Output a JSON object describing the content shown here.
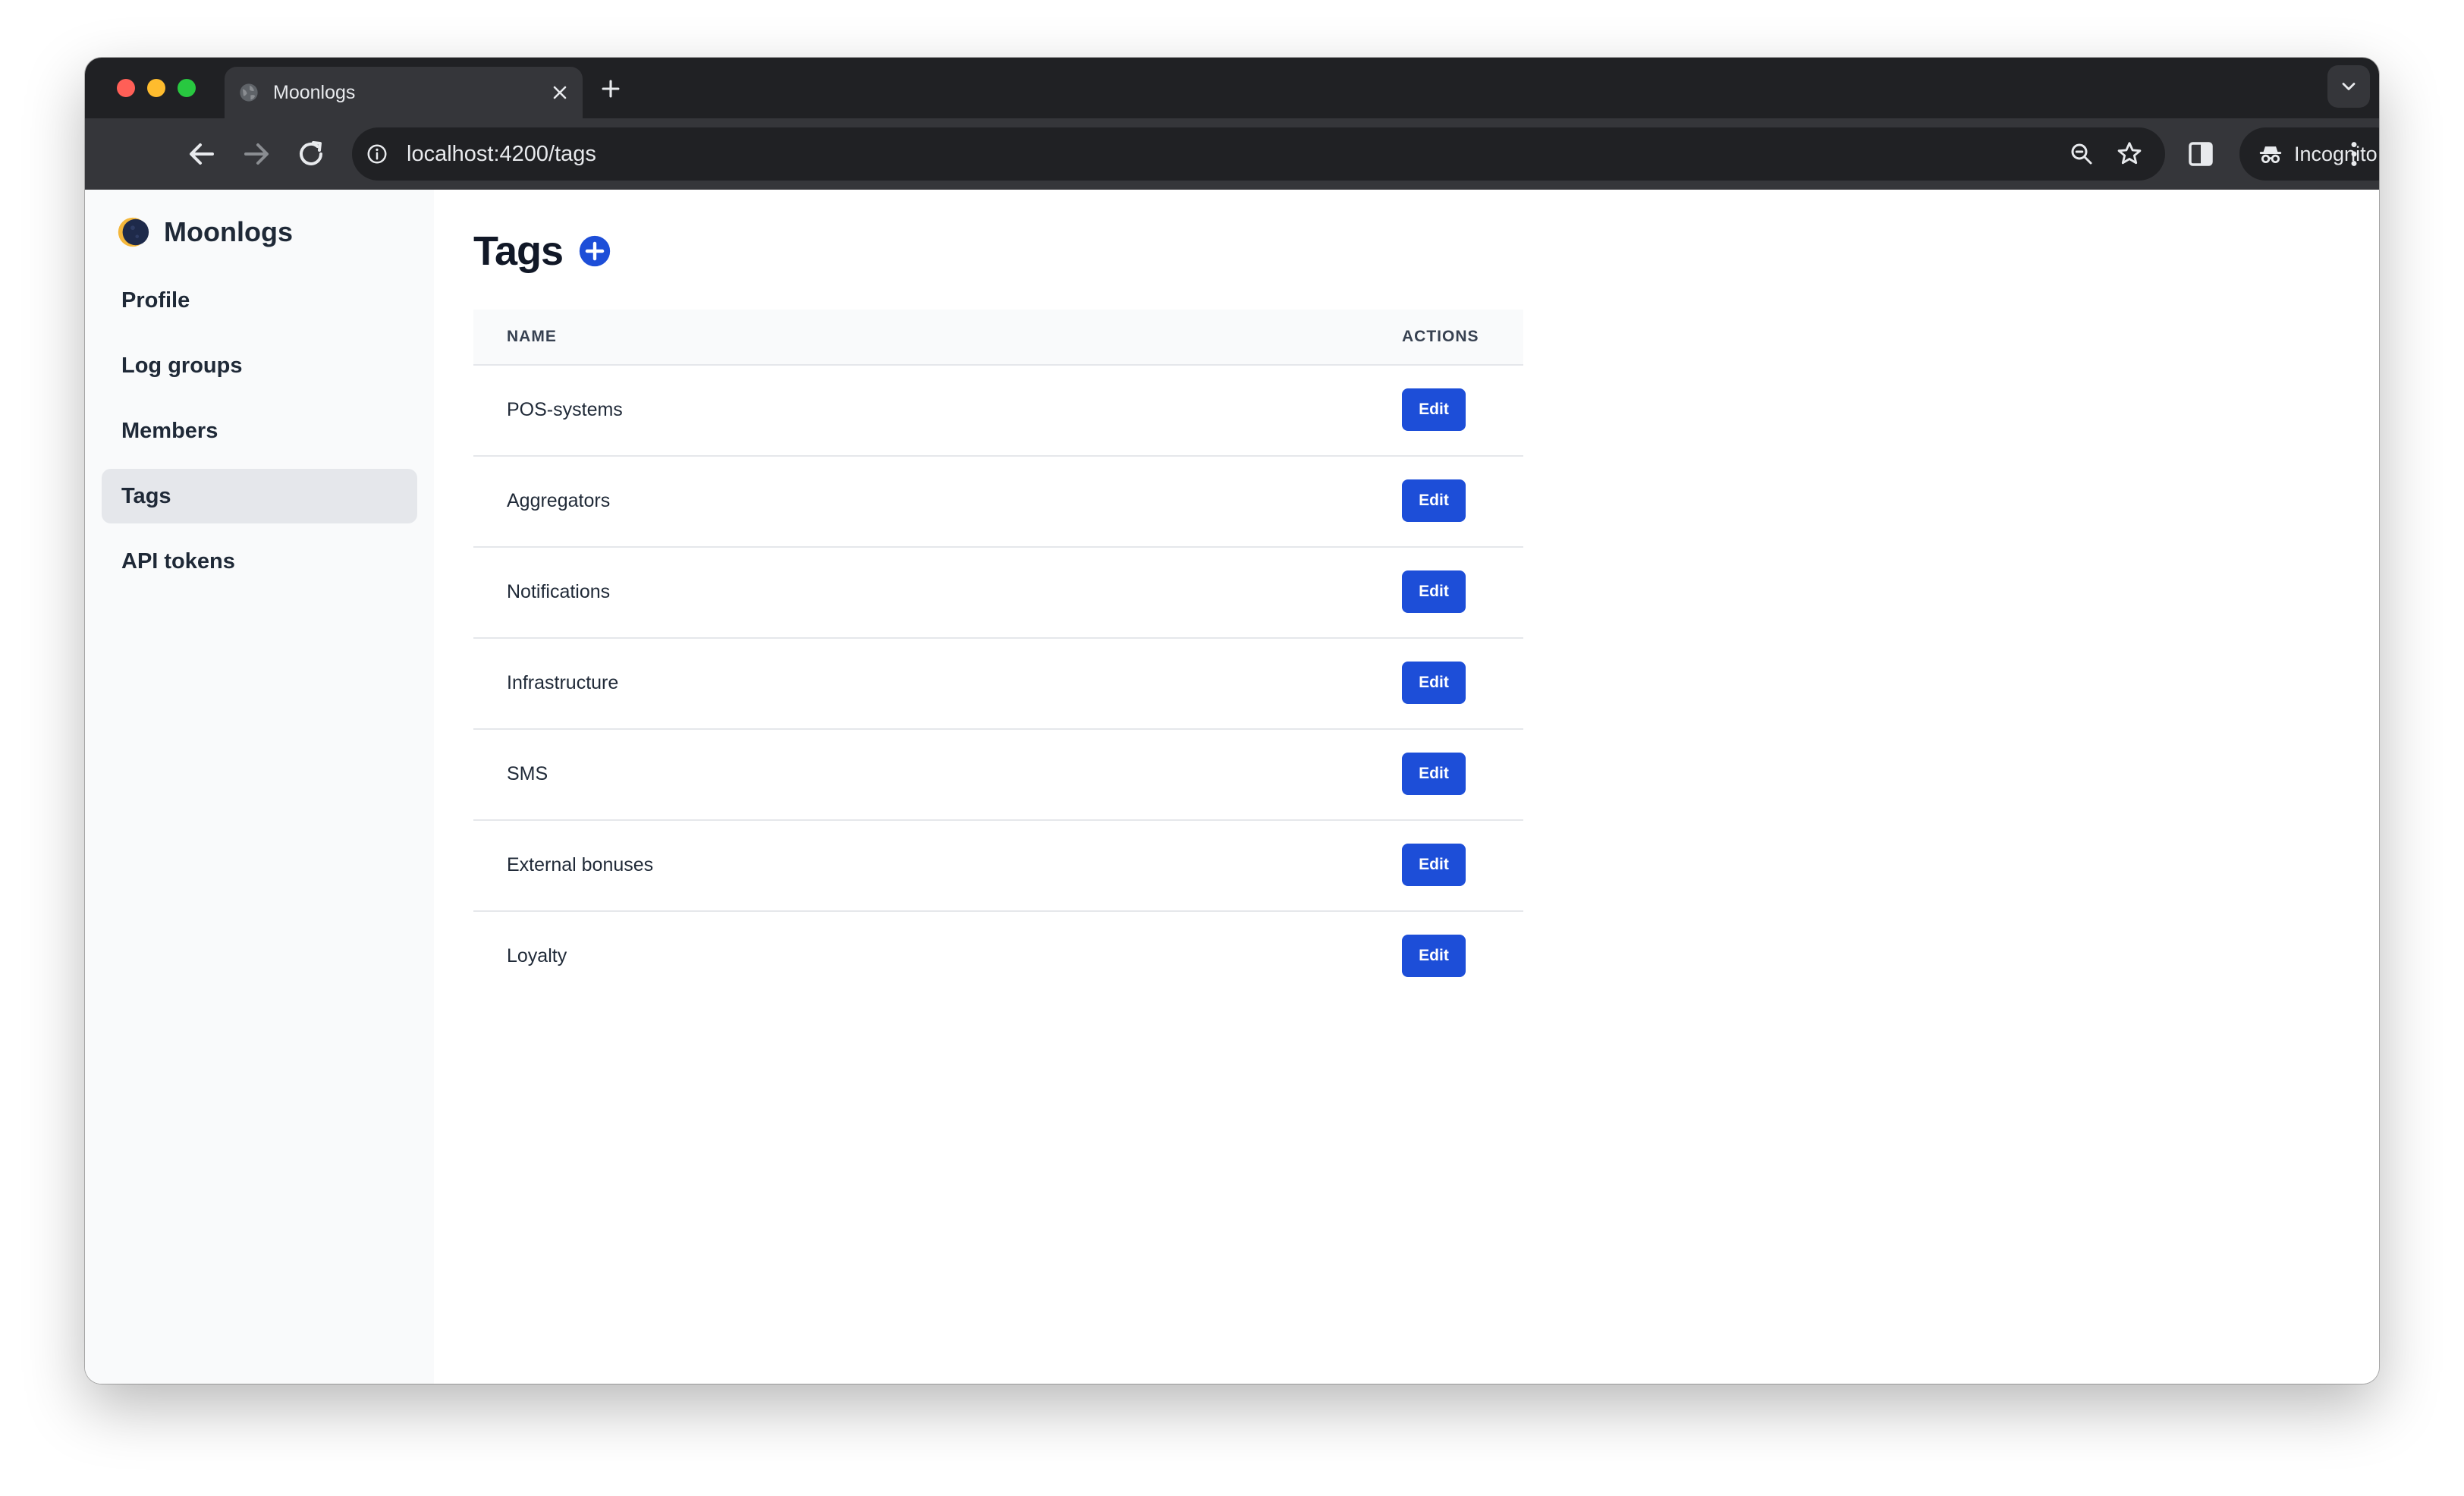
{
  "browser": {
    "tab_title": "Moonlogs",
    "url": "localhost:4200/tags",
    "incognito_label": "Incognito"
  },
  "sidebar": {
    "brand": "Moonlogs",
    "items": [
      {
        "label": "Profile"
      },
      {
        "label": "Log groups"
      },
      {
        "label": "Members"
      },
      {
        "label": "Tags"
      },
      {
        "label": "API tokens"
      }
    ],
    "active": "Tags"
  },
  "main": {
    "title": "Tags",
    "table": {
      "columns": [
        "NAME",
        "ACTIONS"
      ],
      "rows": [
        {
          "name": "POS-systems",
          "action": "Edit"
        },
        {
          "name": "Aggregators",
          "action": "Edit"
        },
        {
          "name": "Notifications",
          "action": "Edit"
        },
        {
          "name": "Infrastructure",
          "action": "Edit"
        },
        {
          "name": "SMS",
          "action": "Edit"
        },
        {
          "name": "External bonuses",
          "action": "Edit"
        },
        {
          "name": "Loyalty",
          "action": "Edit"
        }
      ]
    }
  },
  "icons": {
    "add": "plus-circle-icon",
    "logo": "moon-logo-icon"
  },
  "colors": {
    "accent": "#1d4ed8",
    "sidebar_bg": "#f9fafb",
    "active_item_bg": "#e5e7eb"
  }
}
